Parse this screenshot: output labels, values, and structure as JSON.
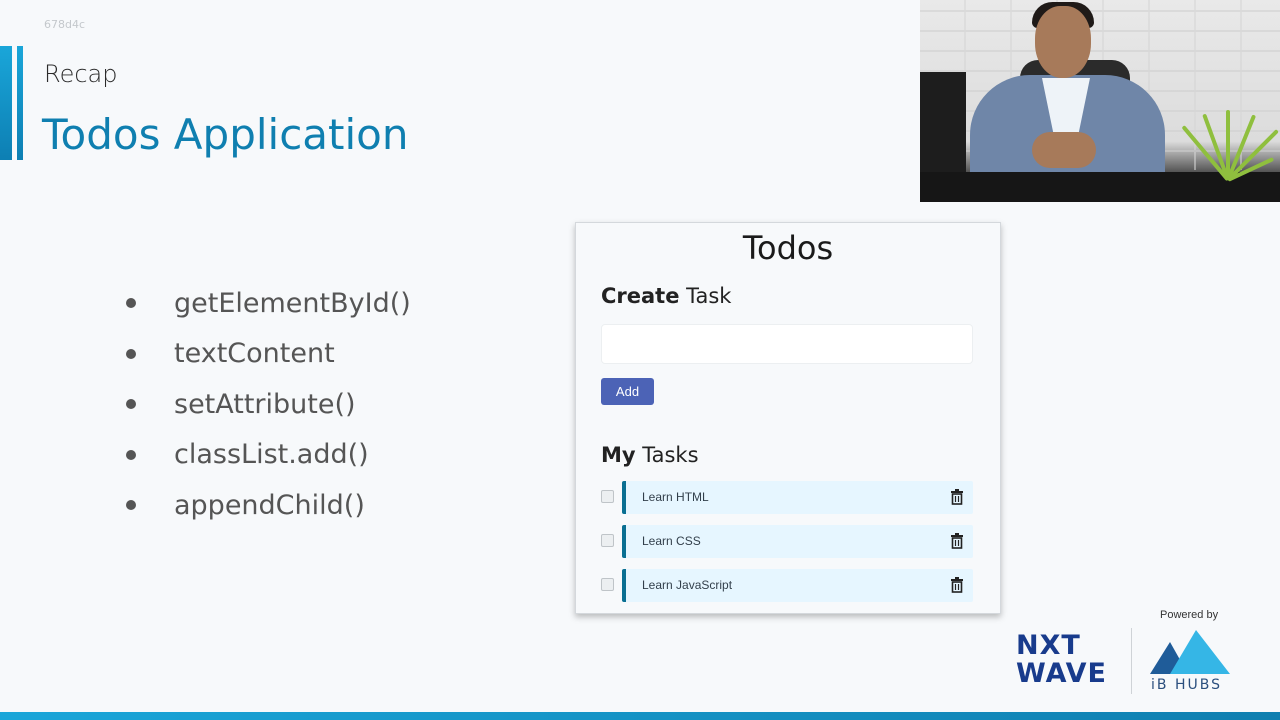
{
  "slide": {
    "id": "678d4c",
    "kicker": "Recap",
    "title": "Todos Application",
    "accent_color": "#0f7fb0"
  },
  "bullets": [
    "getElementById()",
    "textContent",
    "setAttribute()",
    "classList.add()",
    "appendChild()"
  ],
  "todo_app": {
    "heading": "Todos",
    "create_heading_bold": "Create",
    "create_heading_rest": " Task",
    "input_value": "",
    "add_button_label": "Add",
    "my_tasks_bold": "My",
    "my_tasks_rest": " Tasks",
    "tasks": [
      {
        "label": "Learn HTML",
        "checked": false
      },
      {
        "label": "Learn CSS",
        "checked": false
      },
      {
        "label": "Learn JavaScript",
        "checked": false
      }
    ],
    "button_color": "#4c63b6",
    "task_bg_color": "#e6f6ff",
    "task_border_color": "#096f92"
  },
  "branding": {
    "powered_by": "Powered by",
    "nxtwave_line1": "NXT",
    "nxtwave_line2": "WAVE",
    "ibhubs": "iB HUBS"
  }
}
